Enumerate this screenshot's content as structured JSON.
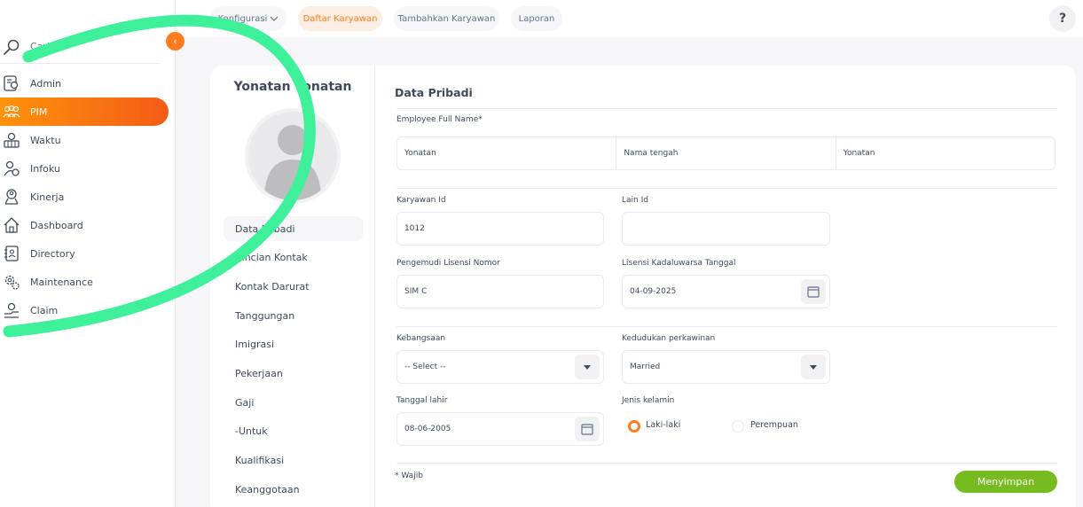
{
  "sidebar": {
    "search_label": "Cari",
    "items": [
      {
        "label": "Admin",
        "icon": "admin-icon"
      },
      {
        "label": "PIM",
        "icon": "pim-icon",
        "active": true
      },
      {
        "label": "Waktu",
        "icon": "time-icon"
      },
      {
        "label": "Infoku",
        "icon": "myinfo-icon"
      },
      {
        "label": "Kinerja",
        "icon": "performance-icon"
      },
      {
        "label": "Dashboard",
        "icon": "home-icon"
      },
      {
        "label": "Directory",
        "icon": "directory-icon"
      },
      {
        "label": "Maintenance",
        "icon": "maintenance-icon"
      },
      {
        "label": "Claim",
        "icon": "claim-icon"
      }
    ],
    "collapse_glyph": "‹"
  },
  "topbar": {
    "tabs": [
      {
        "label": "Konfigurasi",
        "has_dropdown": true
      },
      {
        "label": "Daftar Karyawan",
        "active": true
      },
      {
        "label": "Tambahkan Karyawan"
      },
      {
        "label": "Laporan"
      }
    ],
    "help_label": "?"
  },
  "profile": {
    "name": "Yonatan Yonatan",
    "subnav": [
      {
        "label": "Data Pribadi",
        "active": true
      },
      {
        "label": "Rincian Kontak"
      },
      {
        "label": "Kontak Darurat"
      },
      {
        "label": "Tanggungan"
      },
      {
        "label": "Imigrasi"
      },
      {
        "label": "Pekerjaan"
      },
      {
        "label": "Gaji"
      },
      {
        "label": "-Untuk"
      },
      {
        "label": "Kualifikasi"
      },
      {
        "label": "Keanggotaan"
      }
    ]
  },
  "form": {
    "title": "Data Pribadi",
    "full_name_label": "Employee Full Name*",
    "first_name": "Yonatan",
    "middle_name_placeholder": "Nama tengah",
    "last_name": "Yonatan",
    "employee_id_label": "Karyawan Id",
    "employee_id": "1012",
    "other_id_label": "Lain Id",
    "other_id": "",
    "license_label": "Pengemudi Lisensi Nomor",
    "license": "SIM C",
    "license_expiry_label": "Lisensi Kadaluwarsa Tanggal",
    "license_expiry": "04-09-2025",
    "nationality_label": "Kebangsaan",
    "nationality": "-- Select --",
    "marital_label": "Kedudukan perkawinan",
    "marital": "Married",
    "dob_label": "Tanggal lahir",
    "dob": "08-06-2005",
    "gender_label": "Jenis kelamin",
    "gender_options": [
      {
        "label": "Laki-laki",
        "checked": true
      },
      {
        "label": "Perempuan",
        "checked": false
      }
    ],
    "required_note": "* Wajib",
    "save_label": "Menyimpan"
  },
  "colors": {
    "accent": "#ff7b1d",
    "save": "#76bc21",
    "annotation_stroke": "#3ef09a"
  }
}
